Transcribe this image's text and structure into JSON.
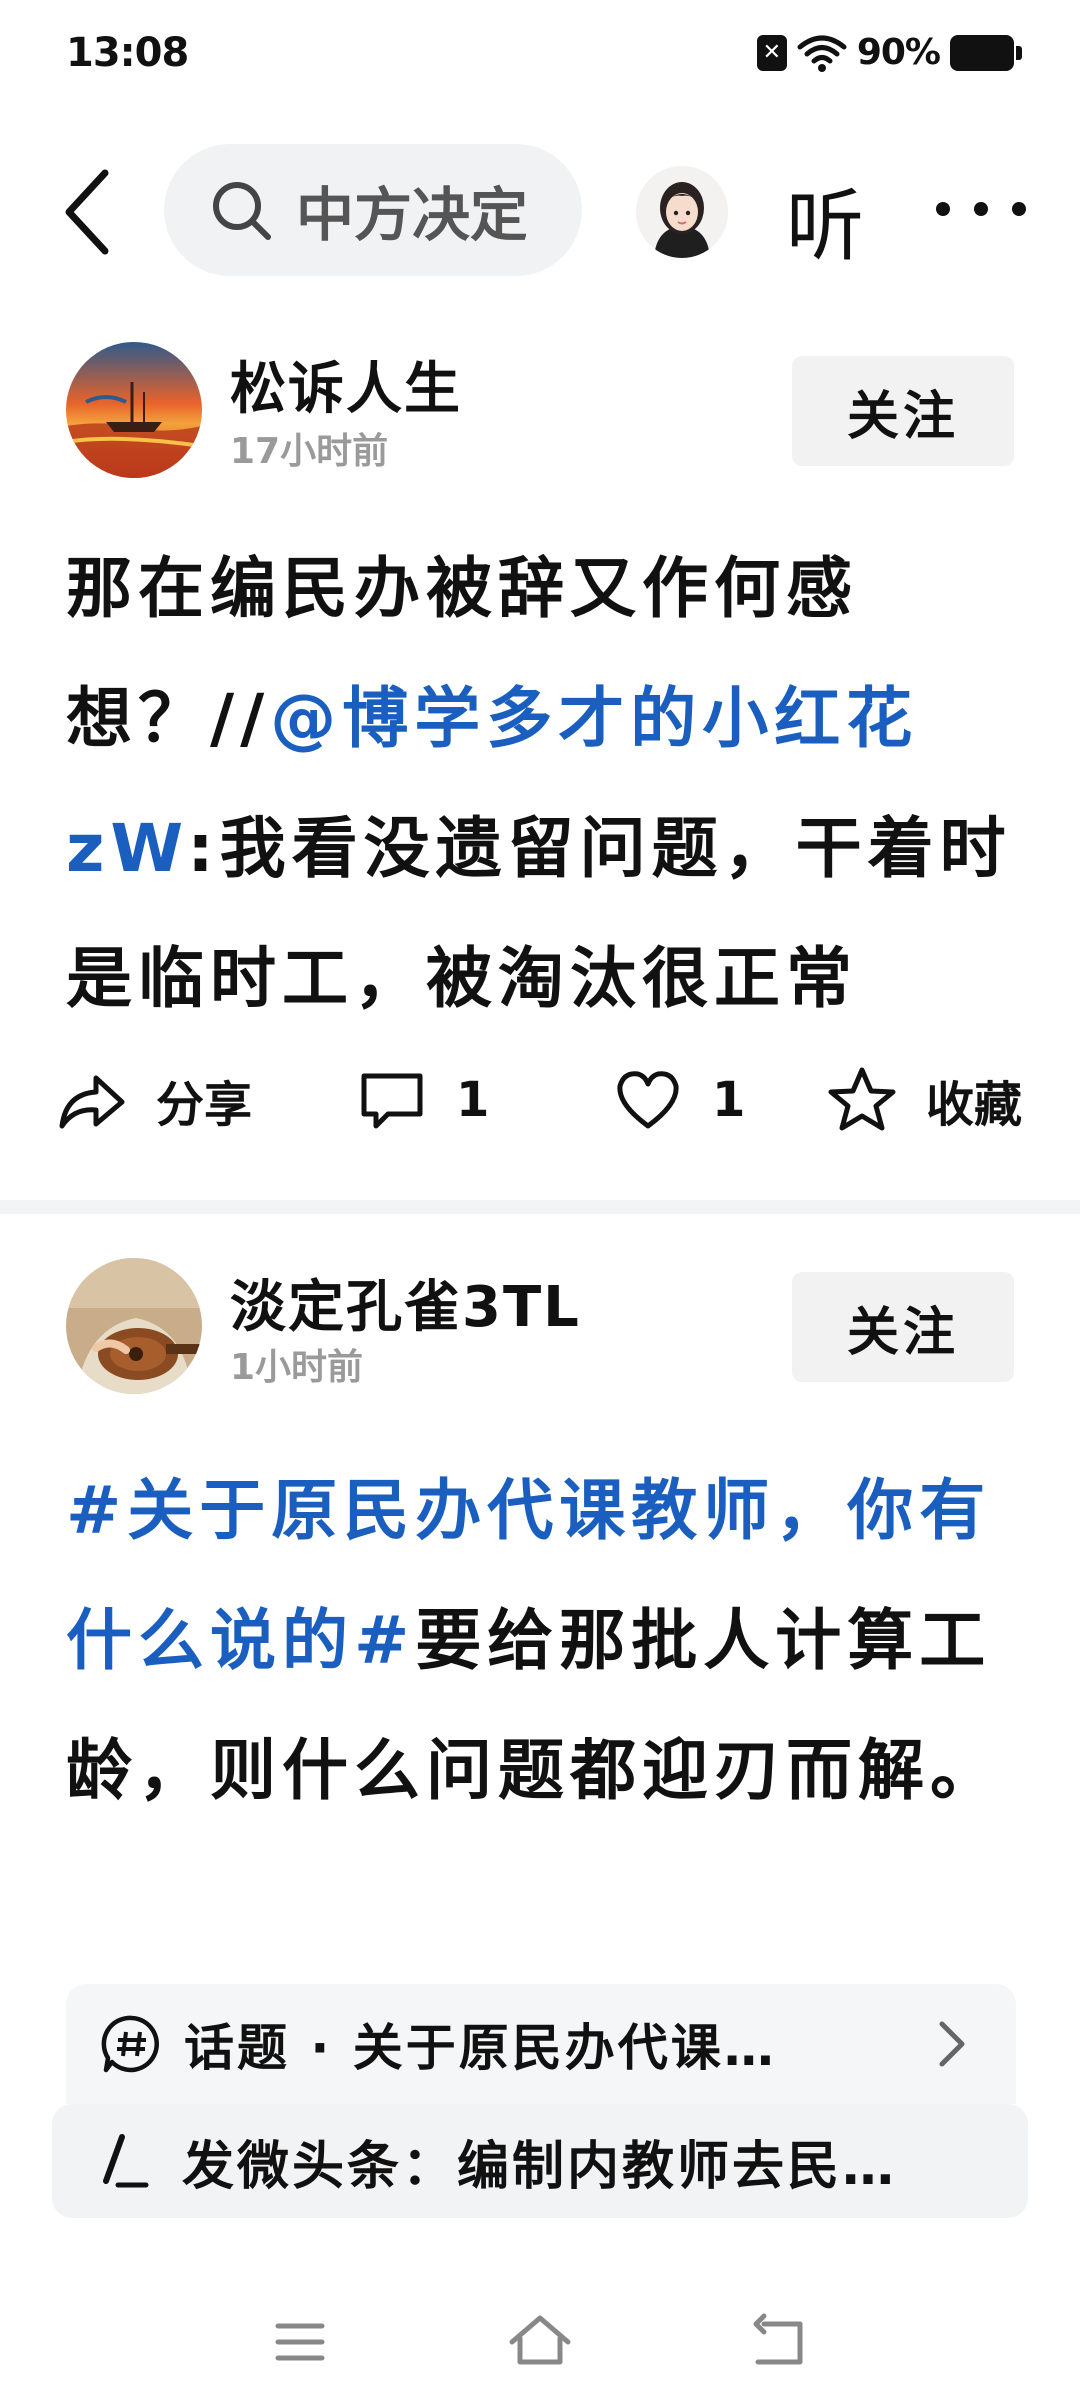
{
  "status_bar": {
    "time": "13:08",
    "sim_icon": "sim-off-icon",
    "wifi_icon": "wifi-icon",
    "battery_percent": "90%",
    "battery_icon": "battery-icon"
  },
  "top_nav": {
    "back_icon": "chevron-left-icon",
    "search_icon": "search-icon",
    "search_text": "中方决定",
    "avatar_icon": "user-avatar",
    "listen_label": "听",
    "more_icon": "more-icon"
  },
  "posts": [
    {
      "user": "松诉人生",
      "time": "17小时前",
      "follow_label": "关注",
      "body": {
        "text1": "那在编民办被辞又作何感想？//",
        "mention": "@博学多才的小红花zW",
        "text2": ":我看没遗留问题，干着时是临时工，被淘汰很正常"
      },
      "actions": {
        "share_label": "分享",
        "comment_count": "1",
        "like_count": "1",
        "favorite_label": "收藏"
      }
    },
    {
      "user": "淡定孔雀3TL",
      "time": "1小时前",
      "follow_label": "关注",
      "body": {
        "hashtag": "#关于原民办代课教师，你有什么说的#",
        "text": "要给那批人计算工龄，则什么问题都迎刃而解。"
      },
      "topic_label": "话题 · 关于原民办代课…"
    }
  ],
  "compose_bar": {
    "label": "发微头条：编制内教师去民…"
  },
  "nav_bar": {
    "menu_icon": "menu-icon",
    "home_icon": "home-icon",
    "back_icon": "back-icon"
  },
  "colors": {
    "link": "#1a5fbf",
    "follow_bg": "#f2f2f2",
    "search_bg": "#f1f2f4"
  }
}
